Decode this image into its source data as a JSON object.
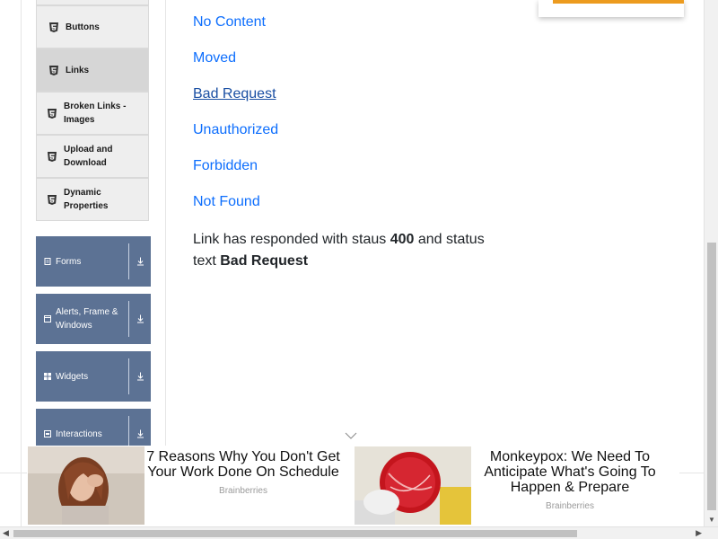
{
  "sidebar": {
    "sub_items": [
      {
        "label": "Buttons"
      },
      {
        "label": "Links"
      },
      {
        "label": "Broken Links - Images"
      },
      {
        "label": "Upload and Download"
      },
      {
        "label": "Dynamic Properties"
      }
    ],
    "groups": [
      {
        "label": "Forms",
        "icon": "document-icon"
      },
      {
        "label": "Alerts, Frame & Windows",
        "icon": "window-icon"
      },
      {
        "label": "Widgets",
        "icon": "grid-icon"
      },
      {
        "label": "Interactions",
        "icon": "interaction-icon"
      }
    ]
  },
  "main": {
    "links": [
      {
        "label": "No Content"
      },
      {
        "label": "Moved"
      },
      {
        "label": "Bad Request"
      },
      {
        "label": "Unauthorized"
      },
      {
        "label": "Forbidden"
      },
      {
        "label": "Not Found"
      }
    ],
    "response": {
      "prefix": "Link has responded with staus",
      "status_code": "400",
      "middle": "and status text",
      "status_text": "Bad Request"
    }
  },
  "ads": [
    {
      "title": "7 Reasons Why You Don't Get Your Work Done On Schedule",
      "source": "Brainberries"
    },
    {
      "title": "Monkeypox: We Need To Anticipate What's Going To Happen & Prepare",
      "source": "Brainberries"
    }
  ],
  "colors": {
    "link": "#0d6efd",
    "group_bg": "#5c7294",
    "accent_orange": "#ec9b1f"
  }
}
